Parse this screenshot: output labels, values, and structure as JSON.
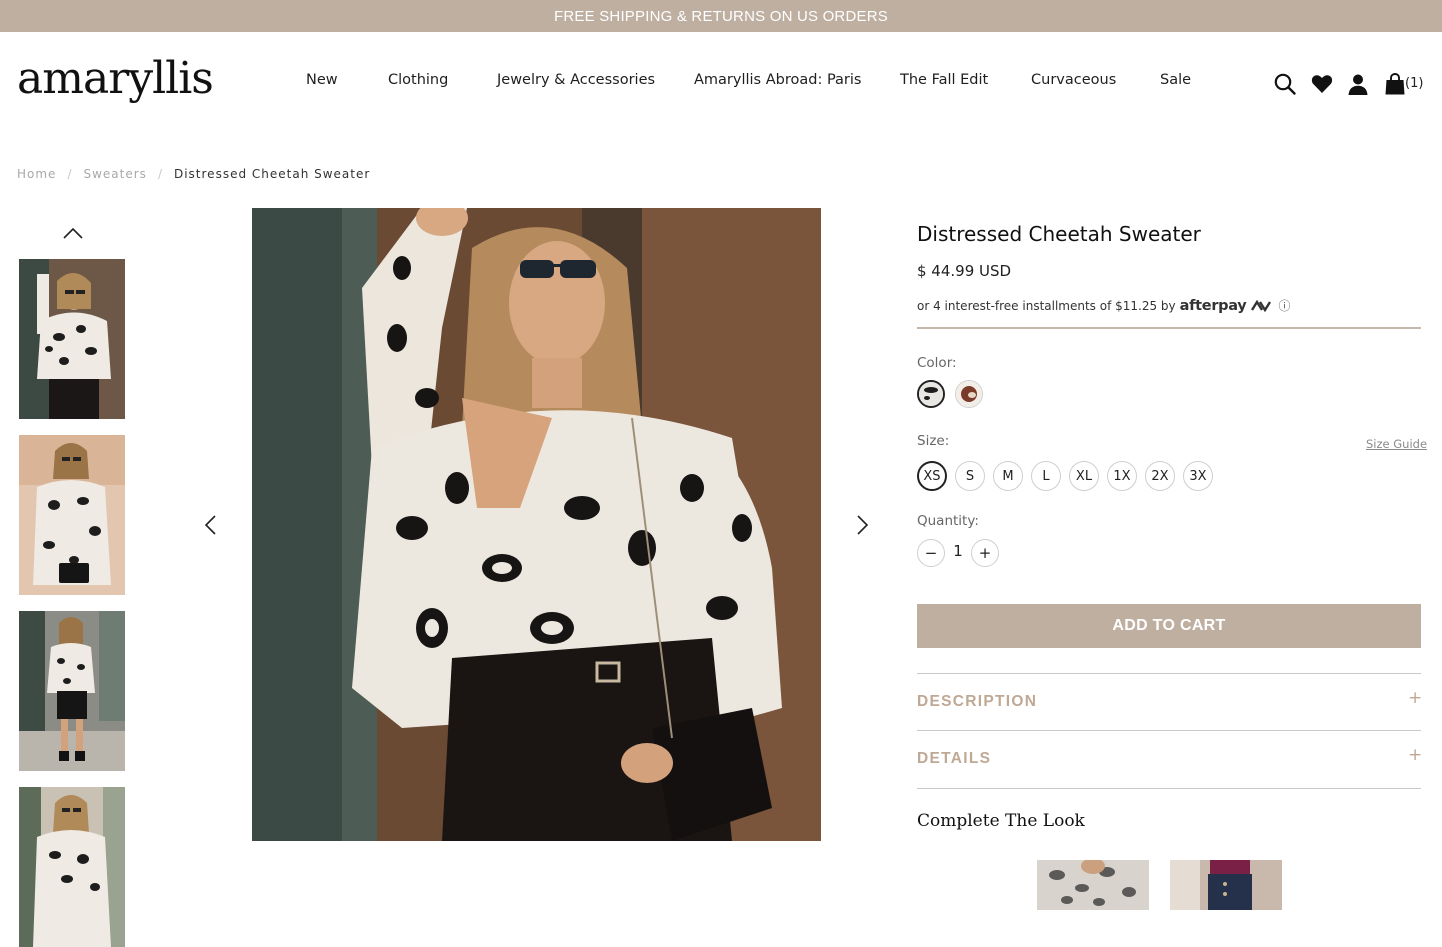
{
  "announcement": "FREE SHIPPING & RETURNS ON US ORDERS",
  "brand": {
    "logo_text": "amaryllis"
  },
  "nav": {
    "items": [
      {
        "label": "New"
      },
      {
        "label": "Clothing"
      },
      {
        "label": "Jewelry & Accessories"
      },
      {
        "label": "Amaryllis Abroad: Paris"
      },
      {
        "label": "The Fall Edit"
      },
      {
        "label": "Curvaceous"
      },
      {
        "label": "Sale"
      }
    ]
  },
  "header_icons": [
    "search-icon",
    "heart-icon",
    "account-icon",
    "shopping-bag-icon"
  ],
  "cart_count": "(1)",
  "breadcrumb": {
    "items": [
      "Home",
      "Sweaters",
      "Distressed Cheetah Sweater"
    ],
    "separator": "/"
  },
  "product": {
    "title": "Distressed Cheetah Sweater",
    "price": "$ 44.99 USD",
    "installments_text": "or 4 interest-free installments of $11.25 by",
    "afterpay_logo": "afterpay",
    "info_glyph": "ⓘ",
    "color_label": "Color:",
    "colors": [
      {
        "name": "white-black",
        "hex": "#e9e7e3",
        "selected": true
      },
      {
        "name": "brown",
        "hex": "#7b3b2a",
        "selected": false
      }
    ],
    "size_label": "Size:",
    "size_guide": "Size Guide",
    "sizes": [
      {
        "label": "XS",
        "selected": true
      },
      {
        "label": "S",
        "selected": false
      },
      {
        "label": "M",
        "selected": false
      },
      {
        "label": "L",
        "selected": false
      },
      {
        "label": "XL",
        "selected": false
      },
      {
        "label": "1X",
        "selected": false
      },
      {
        "label": "2X",
        "selected": false
      },
      {
        "label": "3X",
        "selected": false
      }
    ],
    "quantity_label": "Quantity:",
    "quantity": "1",
    "qty_minus": "−",
    "qty_plus": "+",
    "add_to_cart": "ADD TO CART",
    "accordions": [
      {
        "title": "DESCRIPTION",
        "toggle": "+"
      },
      {
        "title": "DETAILS",
        "toggle": "+"
      }
    ],
    "complete_the_look": "Complete The Look"
  },
  "colors": {
    "accent_tan": "#bfafa1",
    "accordion_text": "#bfa894",
    "text": "#1a1a1a"
  }
}
